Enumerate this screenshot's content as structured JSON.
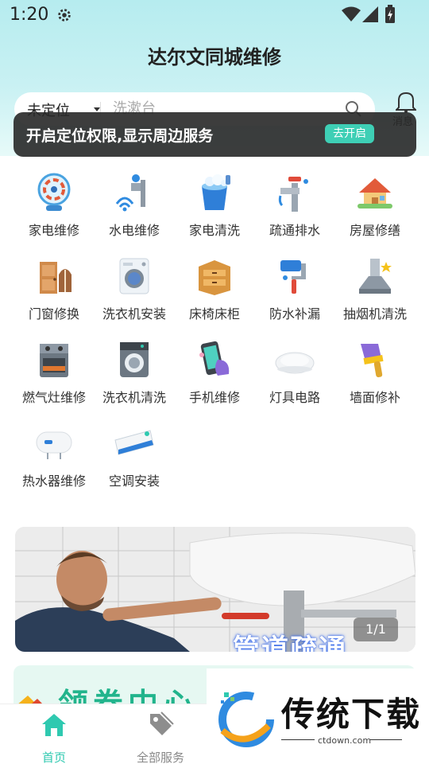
{
  "status_bar": {
    "time": "1:20"
  },
  "header": {
    "title": "达尔文同城维修"
  },
  "search": {
    "location": "未定位",
    "placeholder": "洗漱台"
  },
  "message": {
    "label": "消息"
  },
  "toast": {
    "text": "开启定位权限,显示周边服务",
    "action": "去开启"
  },
  "services": [
    {
      "label": "家电维修",
      "icon": "fan-icon"
    },
    {
      "label": "水电维修",
      "icon": "faucet-wifi-icon"
    },
    {
      "label": "家电清洗",
      "icon": "bucket-icon"
    },
    {
      "label": "疏通排水",
      "icon": "pipe-valve-icon"
    },
    {
      "label": "房屋修缮",
      "icon": "house-icon"
    },
    {
      "label": "门窗修换",
      "icon": "door-window-icon"
    },
    {
      "label": "洗衣机安装",
      "icon": "washing-machine-icon"
    },
    {
      "label": "床椅床柜",
      "icon": "cabinet-icon"
    },
    {
      "label": "防水补漏",
      "icon": "paint-roller-icon"
    },
    {
      "label": "抽烟机清洗",
      "icon": "range-hood-icon"
    },
    {
      "label": "燃气灶维修",
      "icon": "gas-stove-icon"
    },
    {
      "label": "洗衣机清洗",
      "icon": "washer-clean-icon"
    },
    {
      "label": "手机维修",
      "icon": "phone-icon"
    },
    {
      "label": "灯具电路",
      "icon": "ceiling-lamp-icon"
    },
    {
      "label": "墙面修补",
      "icon": "brush-icon"
    },
    {
      "label": "热水器维修",
      "icon": "water-heater-icon"
    },
    {
      "label": "空调安装",
      "icon": "air-conditioner-icon"
    }
  ],
  "banner": {
    "counter": "1/1",
    "overlay_text": "管道疏通"
  },
  "coupon": {
    "text": "领券中心"
  },
  "tabs": [
    {
      "label": "首页",
      "icon": "home-icon",
      "active": true
    },
    {
      "label": "全部服务",
      "icon": "tag-icon",
      "active": false
    }
  ],
  "watermark": {
    "brand": "传统下载",
    "url": "ctdown.com"
  },
  "colors": {
    "accent": "#3ecfb5",
    "tab_active": "#2fc9b0",
    "tab_inactive": "#888888",
    "hero_top": "#b6ecef"
  }
}
